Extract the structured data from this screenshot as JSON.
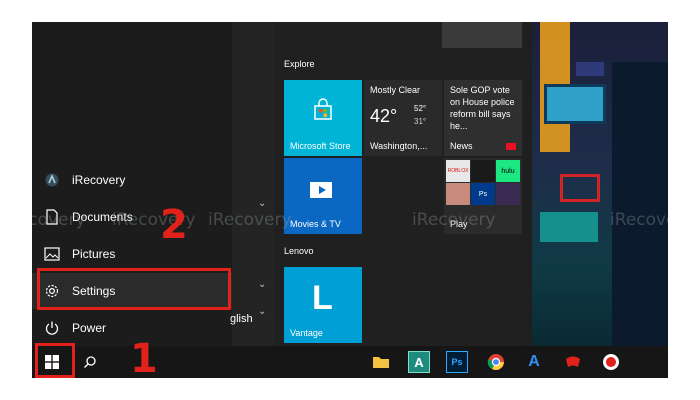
{
  "start_menu": {
    "rail_items": [
      {
        "label": "iRecovery",
        "icon": "irecovery-app-icon"
      },
      {
        "label": "Documents",
        "icon": "document-icon"
      },
      {
        "label": "Pictures",
        "icon": "picture-icon"
      },
      {
        "label": "Settings",
        "icon": "gear-icon"
      },
      {
        "label": "Power",
        "icon": "power-icon"
      }
    ],
    "applist_partial_text": "glish",
    "groups": {
      "explore": "Explore",
      "lenovo": "Lenovo"
    },
    "tiles": {
      "store": {
        "label": "Microsoft Store"
      },
      "weather": {
        "condition": "Mostly Clear",
        "temp": "42°",
        "high": "52°",
        "low": "31°",
        "location": "Washington,..."
      },
      "news": {
        "headline": "Sole GOP vote on House police reform bill says he...",
        "label": "News"
      },
      "movies": {
        "label": "Movies & TV"
      },
      "play": {
        "label": "Play",
        "mini": [
          "ROBLOX",
          "hulu",
          "Ps"
        ]
      },
      "vantage": {
        "label": "Vantage"
      }
    }
  },
  "taskbar": {
    "icons": [
      "windows-start-icon",
      "search-icon",
      "file-explorer-icon",
      "app-a-icon",
      "photoshop-icon",
      "chrome-icon",
      "app-a2-icon",
      "game-icon",
      "record-icon"
    ]
  },
  "annotations": {
    "step1": "1",
    "step2": "2"
  },
  "watermark": "iRecovery",
  "colors": {
    "accent": "#0078d7",
    "store_tile": "#00b4d8",
    "highlight": "#e0221a",
    "news_tile": "#2f2f2f"
  }
}
